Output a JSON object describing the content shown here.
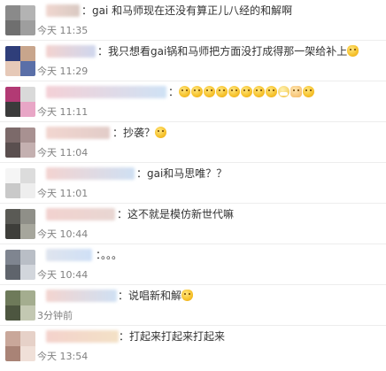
{
  "comments": [
    {
      "text": "：gai 和马师现在还没有算正儿八经的和解啊",
      "time": "今天 11:35",
      "emojis": [],
      "avatar_colors": [
        "#8a8a8a",
        "#b3b3b3",
        "#6f6f6f",
        "#9e9e9e"
      ],
      "name_colors": [
        "#f0d6cf",
        "#d9c9c2"
      ]
    },
    {
      "text": "：我只想看gai锅和马师把方面没打成得那一架给补上",
      "time": "今天 11:29",
      "emojis": [
        "cat-face-emoji"
      ],
      "avatar_colors": [
        "#2f3e7a",
        "#c8a58c",
        "#e6c9b8",
        "#5a6fa8"
      ],
      "name_colors": [
        "#f3d2cf",
        "#cfd7ee"
      ]
    },
    {
      "text": "：",
      "time": "今天 11:11",
      "emojis": [
        "sleeping-face-emoji",
        "crying-face-emoji",
        "dizzy-face-emoji",
        "tongue-face-emoji",
        "smirk-face-emoji",
        "blush-face-emoji",
        "grin-face-emoji",
        "surprised-face-emoji",
        "mask-face-emoji",
        "waving-hand-emoji",
        "thinking-face-emoji"
      ],
      "avatar_colors": [
        "#b23a74",
        "#d9d9d9",
        "#3b3b3b",
        "#e8a6c6"
      ],
      "name_colors": [
        "#f4d0d6",
        "#cfe2f5"
      ]
    },
    {
      "text": "：抄袭？",
      "time": "今天 11:04",
      "emojis": [
        "thinking-face-emoji"
      ],
      "avatar_colors": [
        "#7c6a6a",
        "#a89191",
        "#5a4f4f",
        "#c4b0b0"
      ],
      "name_colors": [
        "#f2d6d0",
        "#e2ccc8"
      ]
    },
    {
      "text": "：gai和马思唯？？",
      "time": "今天 11:01",
      "emojis": [],
      "avatar_colors": [
        "#f5f5f5",
        "#dcdcdc",
        "#c9c9c9",
        "#eeeeee"
      ],
      "name_colors": [
        "#f3d3d0",
        "#cfe0f3"
      ]
    },
    {
      "text": "：这不就是模仿新世代嘛",
      "time": "今天 10:44",
      "emojis": [],
      "avatar_colors": [
        "#5a5a55",
        "#8f8f88",
        "#3e3e3a",
        "#a6a69c"
      ],
      "name_colors": [
        "#f2d2cf",
        "#e8d6d2"
      ]
    },
    {
      "text": "：。。。",
      "time": "今天 10:44",
      "emojis": [],
      "avatar_colors": [
        "#7f8590",
        "#b9bec6",
        "#5f646c",
        "#d2d6dc"
      ],
      "name_colors": [
        "#dfe4ee",
        "#cfe0f6"
      ]
    },
    {
      "text": "：说唱新和解",
      "time": "3分钟前",
      "emojis": [
        "cat-face-emoji"
      ],
      "avatar_colors": [
        "#6e7a5a",
        "#a4ad8f",
        "#4d5640",
        "#c3c8b2"
      ],
      "name_colors": [
        "#f3d4cf",
        "#cfe0f3"
      ]
    },
    {
      "text": "：打起来打起来打起来",
      "time": "今天 13:54",
      "emojis": [],
      "avatar_colors": [
        "#c9a79a",
        "#e6d1c8",
        "#a98376",
        "#f0e0d8"
      ],
      "name_colors": [
        "#f4d2cc",
        "#f3e1c6"
      ]
    }
  ]
}
